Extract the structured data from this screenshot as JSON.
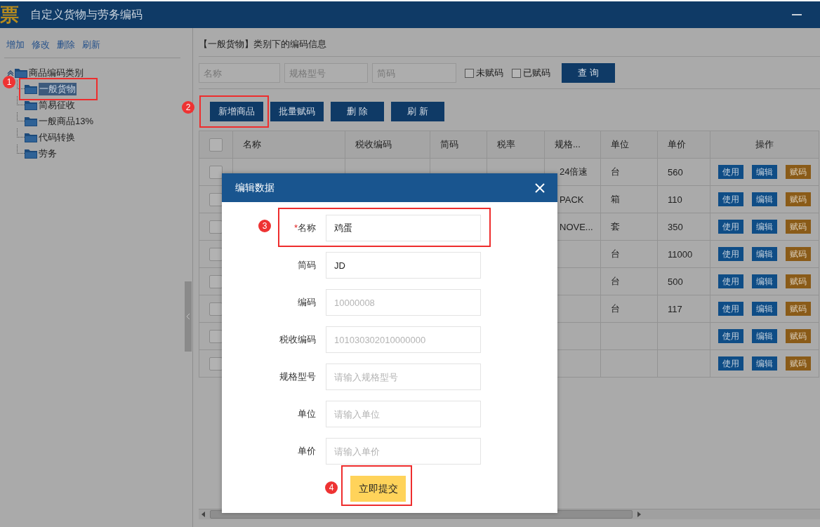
{
  "window": {
    "logo": "票",
    "title": "自定义货物与劳务编码"
  },
  "sidebar": {
    "actions": [
      "增加",
      "修改",
      "删除",
      "刷新"
    ],
    "tree": [
      {
        "label": "商品编码类别",
        "expanded": true,
        "selected": false,
        "children": [
          {
            "label": "一般货物",
            "selected": true,
            "marker": "1"
          },
          {
            "label": "简易征收",
            "selected": false
          },
          {
            "label": "一般商品13%",
            "selected": false
          },
          {
            "label": "代码转换",
            "selected": false
          },
          {
            "label": "劳务",
            "selected": false
          }
        ]
      }
    ]
  },
  "main": {
    "heading": "【一般货物】类别下的编码信息",
    "search": {
      "fields": [
        {
          "placeholder": "名称"
        },
        {
          "placeholder": "规格型号"
        },
        {
          "placeholder": "简码"
        }
      ],
      "filters": [
        {
          "label": "未赋码",
          "checked": false
        },
        {
          "label": "已赋码",
          "checked": false
        }
      ],
      "button": "查 询"
    },
    "toolbar": [
      {
        "label": "新增商品",
        "marker": "2"
      },
      {
        "label": "批量赋码"
      },
      {
        "label": "删 除"
      },
      {
        "label": "刷 新"
      }
    ],
    "table": {
      "select_all_checked": false,
      "columns": [
        "名称",
        "税收编码",
        "简码",
        "税率",
        "规格...",
        "单位",
        "单价",
        "操作"
      ],
      "rows": [
        {
          "checked": false,
          "cells": [
            null,
            null,
            null,
            null,
            "24倍速",
            "台",
            "560"
          ],
          "actions": [
            "使用",
            "编辑",
            "赋码"
          ]
        },
        {
          "checked": false,
          "cells": [
            null,
            null,
            null,
            null,
            "PACK",
            "箱",
            "110"
          ],
          "actions": [
            "使用",
            "编辑",
            "赋码"
          ]
        },
        {
          "checked": false,
          "cells": [
            null,
            null,
            null,
            null,
            "NOVE...",
            "套",
            "350"
          ],
          "actions": [
            "使用",
            "编辑",
            "赋码"
          ]
        },
        {
          "checked": false,
          "cells": [
            null,
            null,
            null,
            null,
            null,
            "台",
            "11000"
          ],
          "actions": [
            "使用",
            "编辑",
            "赋码"
          ]
        },
        {
          "checked": false,
          "cells": [
            null,
            null,
            null,
            null,
            null,
            "台",
            "500"
          ],
          "actions": [
            "使用",
            "编辑",
            "赋码"
          ]
        },
        {
          "checked": false,
          "cells": [
            null,
            null,
            null,
            null,
            null,
            "台",
            "117"
          ],
          "actions": [
            "使用",
            "编辑",
            "赋码"
          ]
        },
        {
          "checked": false,
          "cells": [
            null,
            null,
            null,
            null,
            null,
            null,
            null
          ],
          "actions": [
            "使用",
            "编辑",
            "赋码"
          ]
        },
        {
          "checked": false,
          "cells": [
            null,
            null,
            null,
            null,
            null,
            null,
            null
          ],
          "actions": [
            "使用",
            "编辑",
            "赋码"
          ]
        }
      ]
    }
  },
  "dialog": {
    "title": "编辑数据",
    "fields": [
      {
        "required_mark": "*",
        "label": "名称",
        "value": "鸡蛋",
        "marker": "3"
      },
      {
        "label": "简码",
        "value": "JD"
      },
      {
        "label": "编码",
        "placeholder": "10000008"
      },
      {
        "label": "税收编码",
        "placeholder": "101030302010000000"
      },
      {
        "label": "规格型号",
        "placeholder": "请输入规格型号"
      },
      {
        "label": "单位",
        "placeholder": "请输入单位"
      },
      {
        "label": "单价",
        "placeholder": "请输入单价"
      }
    ],
    "submit": {
      "label": "立即提交",
      "marker": "4"
    }
  }
}
